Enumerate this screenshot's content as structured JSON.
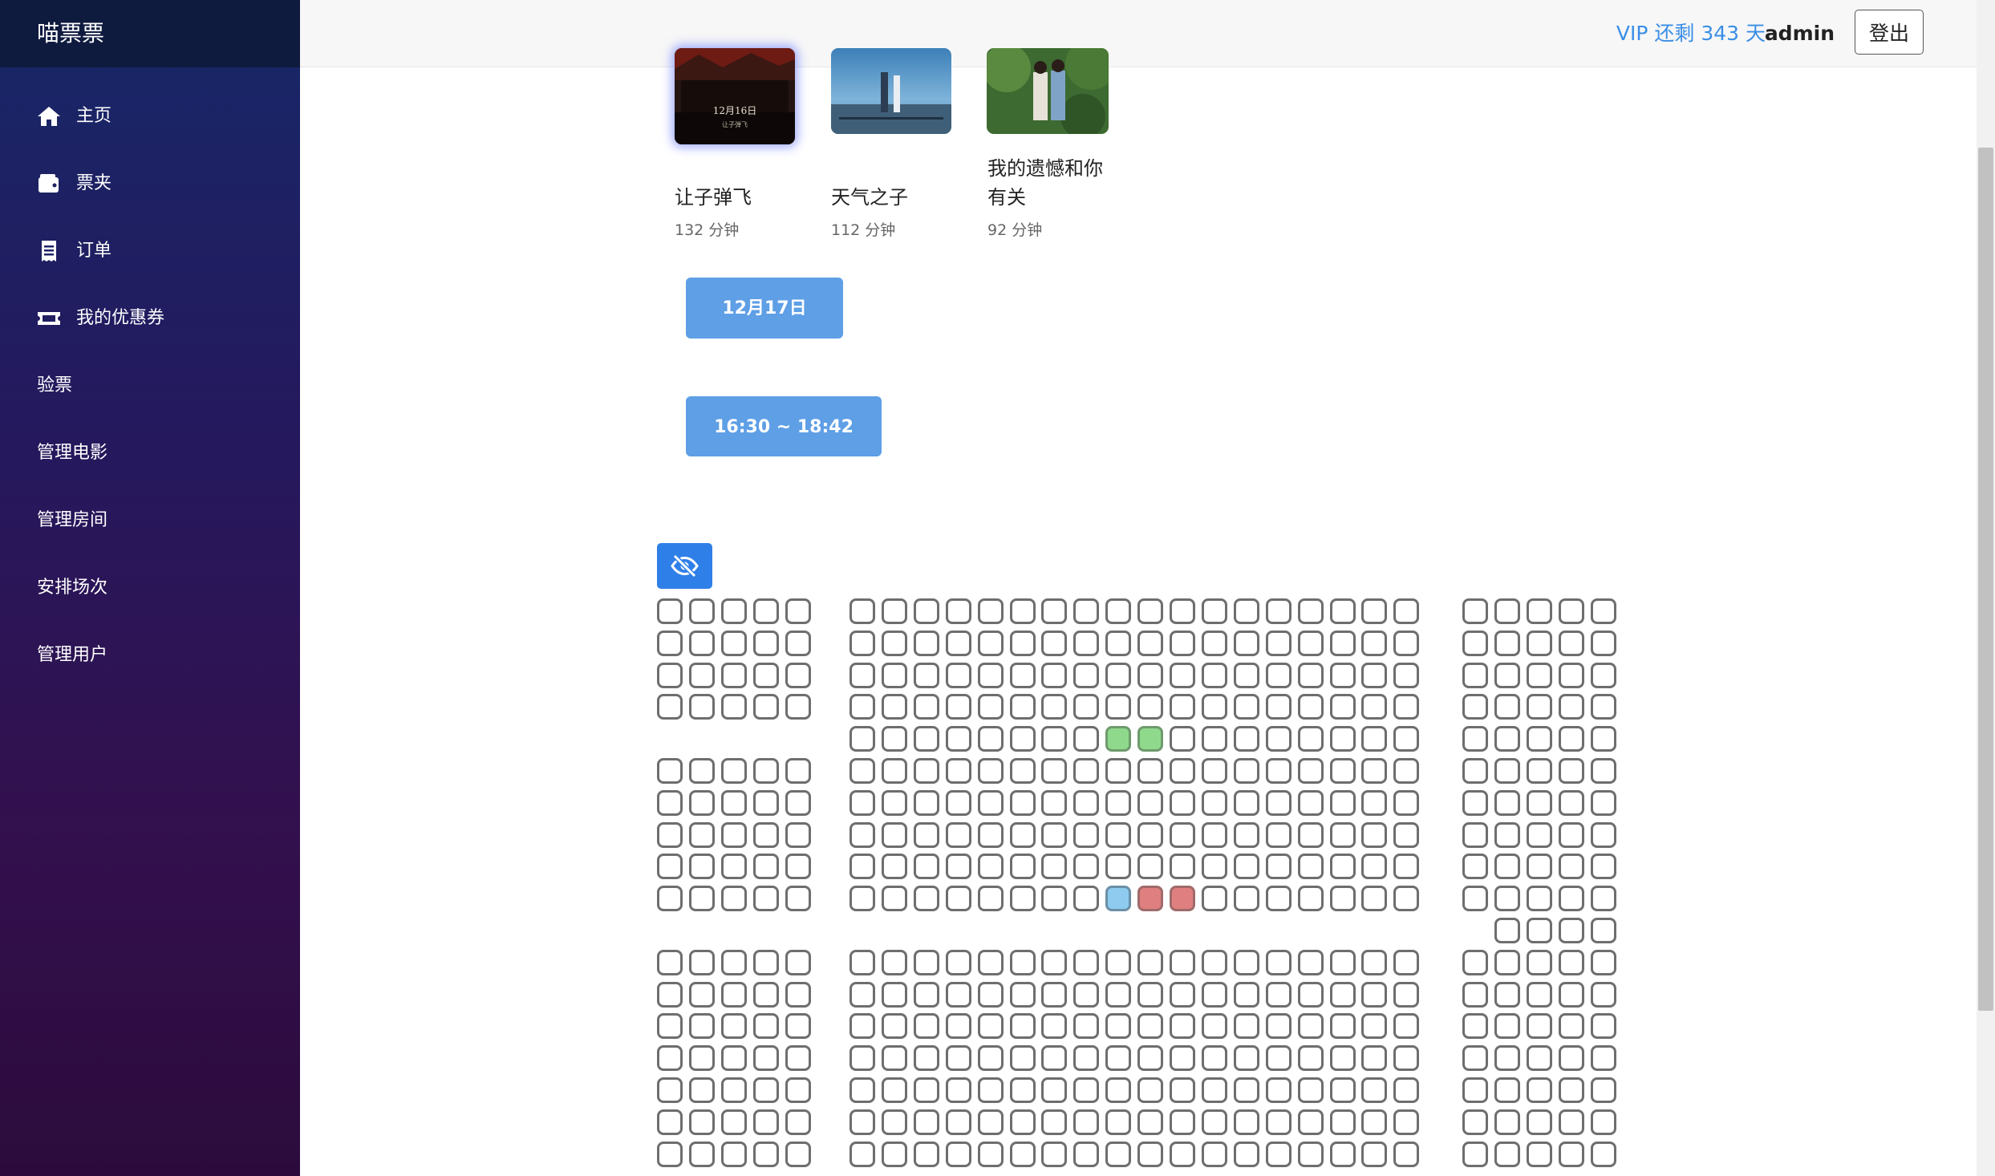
{
  "app": {
    "brand": "喵票票"
  },
  "sidebar": {
    "items": [
      {
        "label": "主页",
        "icon": "home-icon"
      },
      {
        "label": "票夹",
        "icon": "wallet-icon"
      },
      {
        "label": "订单",
        "icon": "receipt-icon"
      },
      {
        "label": "我的优惠券",
        "icon": "ticket-icon"
      },
      {
        "label": "验票"
      },
      {
        "label": "管理电影"
      },
      {
        "label": "管理房间"
      },
      {
        "label": "安排场次"
      },
      {
        "label": "管理用户"
      }
    ]
  },
  "header": {
    "vip": "VIP 还剩 343 天",
    "user": "admin",
    "logout": "登出"
  },
  "movies": [
    {
      "title": "让子弹飞",
      "duration": "132 分钟"
    },
    {
      "title": "天气之子",
      "duration": "112 分钟"
    },
    {
      "title": "我的遗憾和你有关",
      "duration": "92 分钟"
    }
  ],
  "poster_texts": {
    "movie1": "12月16日",
    "movie1_sub": "让子弹飞"
  },
  "schedule": {
    "date": "12月17日",
    "time": "16:30 ~ 18:42"
  },
  "seat_toggle": {
    "icon": "eye-slash-icon"
  },
  "seat_status": {
    "selected": [
      [
        4,
        8
      ],
      [
        4,
        9
      ]
    ],
    "mine": [
      [
        9,
        8
      ]
    ],
    "sold": [
      [
        9,
        9
      ],
      [
        9,
        10
      ]
    ]
  },
  "colors": {
    "selected": "#8fd98c",
    "mine": "#8ecbee",
    "sold": "#e07f7f",
    "accent": "#5e9fe6",
    "vip": "#3a8ee6"
  }
}
